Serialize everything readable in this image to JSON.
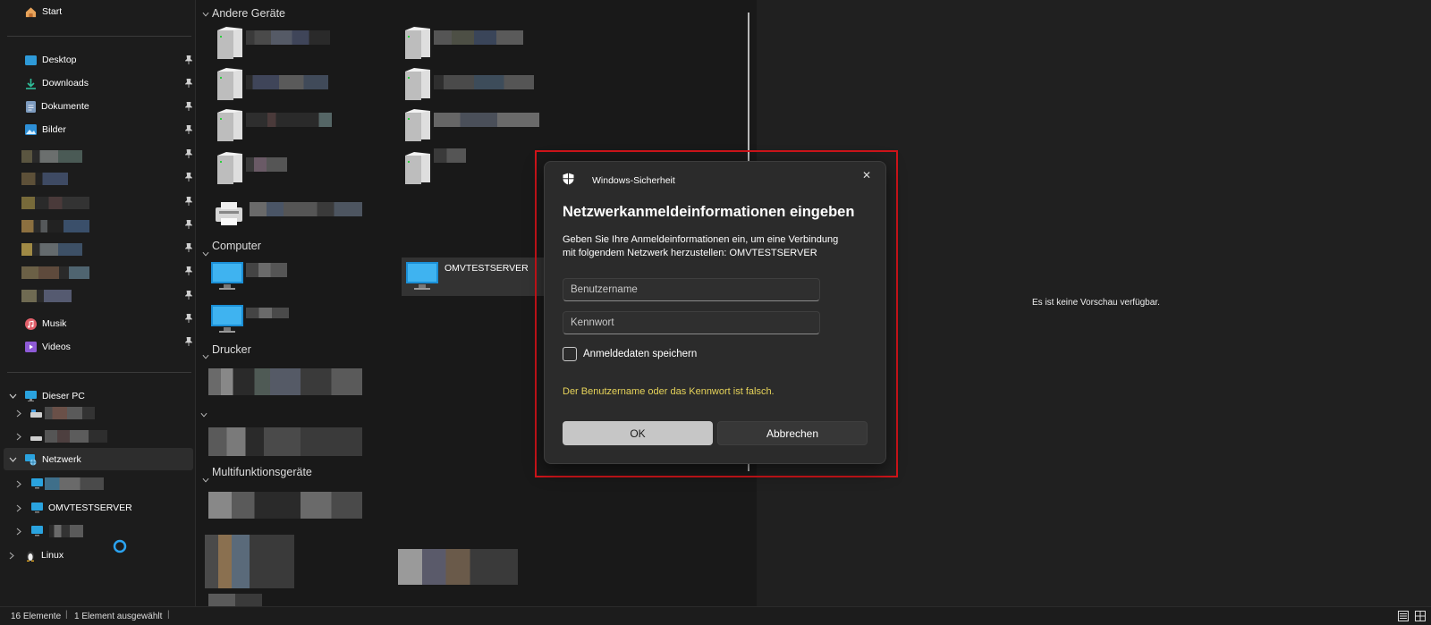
{
  "sidebar": {
    "home": "Start",
    "pinned": [
      {
        "label": "Desktop",
        "icon": "desktop-icon"
      },
      {
        "label": "Downloads",
        "icon": "download-icon"
      },
      {
        "label": "Dokumente",
        "icon": "document-icon"
      },
      {
        "label": "Bilder",
        "icon": "pictures-icon"
      }
    ],
    "pinned_media": [
      {
        "label": "Musik",
        "icon": "music-icon"
      },
      {
        "label": "Videos",
        "icon": "videos-icon"
      }
    ],
    "this_pc": "Dieser PC",
    "network": "Netzwerk",
    "network_child_server": "OMVTESTSERVER",
    "linux": "Linux"
  },
  "main": {
    "sections": {
      "other_devices": "Andere Geräte",
      "computer": "Computer",
      "printers": "Drucker",
      "multifunction": "Multifunktionsgeräte"
    },
    "selected_computer": "OMVTESTSERVER"
  },
  "preview": {
    "empty_text": "Es ist keine Vorschau verfügbar."
  },
  "status": {
    "count": "16 Elemente",
    "selected": "1 Element ausgewählt"
  },
  "dialog": {
    "app_title": "Windows-Sicherheit",
    "heading": "Netzwerkanmeldeinformationen eingeben",
    "description_line1": "Geben Sie Ihre Anmeldeinformationen ein, um eine Verbindung",
    "description_line2": "mit folgendem Netzwerk herzustellen: OMVTESTSERVER",
    "username_placeholder": "Benutzername",
    "password_placeholder": "Kennwort",
    "remember_label": "Anmeldedaten speichern",
    "remember_checked": false,
    "error": "Der Benutzername oder das Kennwort ist falsch.",
    "ok": "OK",
    "cancel": "Abbrechen",
    "close_glyph": "✕"
  },
  "colors": {
    "error_text": "#e6d35a",
    "highlight_border": "#d0141a",
    "selection_bg": "#2d2d2d"
  }
}
